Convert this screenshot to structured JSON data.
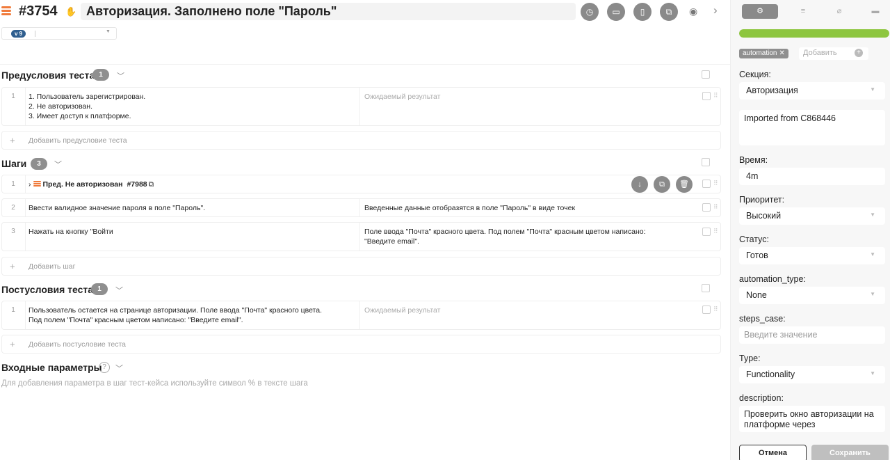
{
  "header": {
    "case_id": "#3754",
    "title": "Авторизация. Заполнено поле \"Пароль\"",
    "version": "v 9"
  },
  "preconditions": {
    "title": "Предусловия теста",
    "count": "1",
    "rows": [
      {
        "num": "1",
        "text": "1. Пользователь зарегистрирован.\n2. Не авторизован.\n3. Имеет доступ к платформе.",
        "expected": "Ожидаемый результат"
      }
    ],
    "add_label": "Добавить предусловие теста"
  },
  "steps": {
    "title": "Шаги",
    "count": "3",
    "shared": {
      "num": "1",
      "title": "Пред. Не авторизован",
      "ref": "#7988"
    },
    "rows": [
      {
        "num": "2",
        "text": "Ввести валидное значение пароля в поле \"Пароль\".",
        "expected": "Введенные данные отобразятся в поле \"Пароль\" в виде точек"
      },
      {
        "num": "3",
        "text": "Нажать на кнопку \"Войти",
        "expected": "Поле ввода \"Почта\" красного цвета. Под полем \"Почта\" красным цветом написано:\n\"Введите email\"."
      }
    ],
    "add_label": "Добавить шаг"
  },
  "postconditions": {
    "title": "Постусловия теста",
    "count": "1",
    "rows": [
      {
        "num": "1",
        "text": "Пользователь остается на странице авторизации. Поле ввода \"Почта\" красного цвета.\nПод полем \"Почта\" красным цветом написано: \"Введите email\".",
        "expected": "Ожидаемый результат"
      }
    ],
    "add_label": "Добавить постусловие теста"
  },
  "params": {
    "title": "Входные параметры",
    "help": "?",
    "hint": "Для добавления параметра в шаг тест-кейса используйте символ % в тексте шага"
  },
  "sidebar": {
    "progress_fraction": 1.0,
    "progress_color": "#8dc63f",
    "tags": [
      "automation"
    ],
    "tag_add_placeholder": "Добавить",
    "fields": {
      "section": {
        "label": "Секция:",
        "value": "Авторизация"
      },
      "imported": "Imported from C868446",
      "time": {
        "label": "Время:",
        "value": "4m"
      },
      "priority": {
        "label": "Приоритет:",
        "value": "Высокий"
      },
      "status": {
        "label": "Статус:",
        "value": "Готов"
      },
      "automation_type": {
        "label": "automation_type:",
        "value": "None"
      },
      "steps_case": {
        "label": "steps_case:",
        "placeholder": "Введите значение"
      },
      "type": {
        "label": "Type:",
        "value": "Functionality"
      },
      "description": {
        "label": "description:",
        "value": "Проверить окно авторизации на платформе через"
      }
    },
    "cancel_label": "Отмена",
    "save_label": "Сохранить"
  }
}
